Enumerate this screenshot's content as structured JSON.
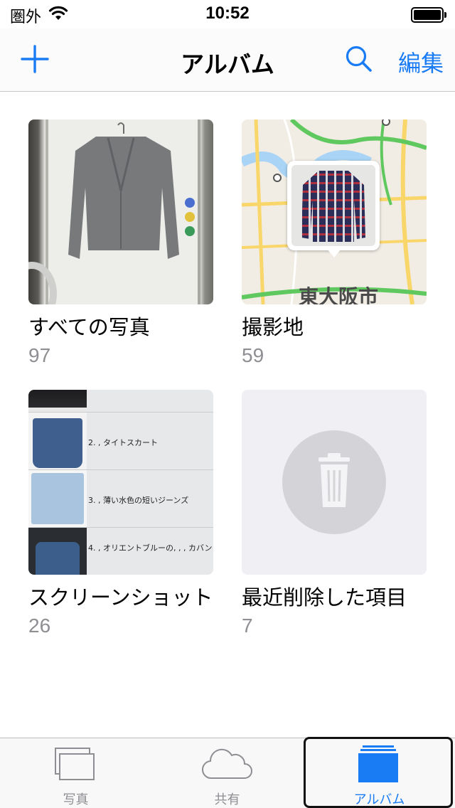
{
  "status_bar": {
    "carrier": "圏外",
    "time": "10:52",
    "wifi_icon": "wifi-icon",
    "battery_icon": "battery-icon"
  },
  "nav": {
    "title": "アルバム",
    "edit_label": "編集",
    "add_icon": "plus-icon",
    "search_icon": "search-icon",
    "accent_color": "#1a7cf5"
  },
  "albums": [
    {
      "name": "すべての写真",
      "count": "97"
    },
    {
      "name": "撮影地",
      "count": "59",
      "map_label": "東大阪市"
    },
    {
      "name": "スクリーンショット",
      "count": "26",
      "rows": [
        {
          "label": ""
        },
        {
          "label": "2. , タイトスカート"
        },
        {
          "label": "3. , 薄い水色の短いジーンズ"
        },
        {
          "label": "4. , オリエントブルーの, , , カバン"
        }
      ]
    },
    {
      "name": "最近削除した項目",
      "count": "7",
      "icon": "trash-icon"
    }
  ],
  "tabs": [
    {
      "label": "写真",
      "icon": "photos-stack-icon",
      "active": false
    },
    {
      "label": "共有",
      "icon": "cloud-icon",
      "active": false
    },
    {
      "label": "アルバム",
      "icon": "albums-icon",
      "active": true
    }
  ]
}
